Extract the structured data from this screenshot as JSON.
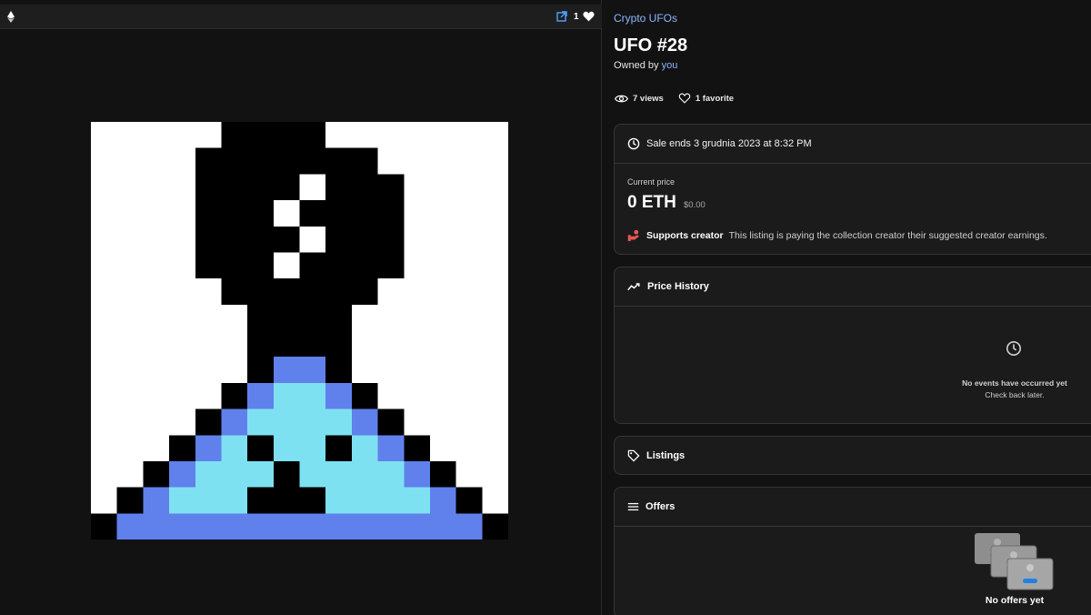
{
  "media": {
    "chain_icon": "ethereum-icon",
    "open_icon": "external-link-icon",
    "favorite_count": "1",
    "favorite_icon": "heart-filled-icon",
    "artwork": {
      "description_icon": "pixel-art-ufo",
      "palette": {
        "K": "#000000",
        "W": "#ffffff",
        "L": "#7ee1f1",
        "B": "#6080ec"
      },
      "grid": [
        "WWWWWKKKKWWWWWWW",
        "WWWWKKKKKKKWWWWW",
        "WWWWKKKKWKKKWWWW",
        "WWWWKKKWKKKKWWWW",
        "WWWWKKKKWKKKWWWW",
        "WWWWKKKWKKKKWWWW",
        "WWWWWKKKKKKWWWWW",
        "WWWWWWKKKKWWWWWW",
        "WWWWWWKKKKWWWWWW",
        "WWWWWWKBBKWWWWWW",
        "WWWWWKBLLBKWWWWW",
        "WWWWKBLLLLBKWWWW",
        "WWWKBLKLLKLBKWWW",
        "WWKBLLLKLLLLBKWW",
        "WKBLLLKKKLLLLBKW",
        "KBBBBBBBBBBBBBBK"
      ]
    }
  },
  "header": {
    "collection": "Crypto UFOs",
    "title": "UFO #28",
    "owned_prefix": "Owned by",
    "owner": "you"
  },
  "stats": {
    "views": "7 views",
    "favorites": "1 favorite"
  },
  "sale": {
    "ends_text": "Sale ends 3 grudnia 2023 at 8:32 PM",
    "current_price_label": "Current price",
    "price": "0 ETH",
    "price_usd": "$0.00",
    "supports_creator_title": "Supports creator",
    "supports_creator_text": "This listing is paying the collection creator their suggested creator earnings."
  },
  "price_history": {
    "title": "Price History",
    "empty_title": "No events have occurred yet",
    "empty_subtitle": "Check back later."
  },
  "listings": {
    "title": "Listings"
  },
  "offers": {
    "title": "Offers",
    "empty_text": "No offers yet"
  },
  "colors": {
    "background": "#121212",
    "panel": "#1b1b1b",
    "border": "#353535",
    "link": "#8ab7ff",
    "accent_blue": "#2081e2",
    "creator_icon": "#eb5757"
  }
}
